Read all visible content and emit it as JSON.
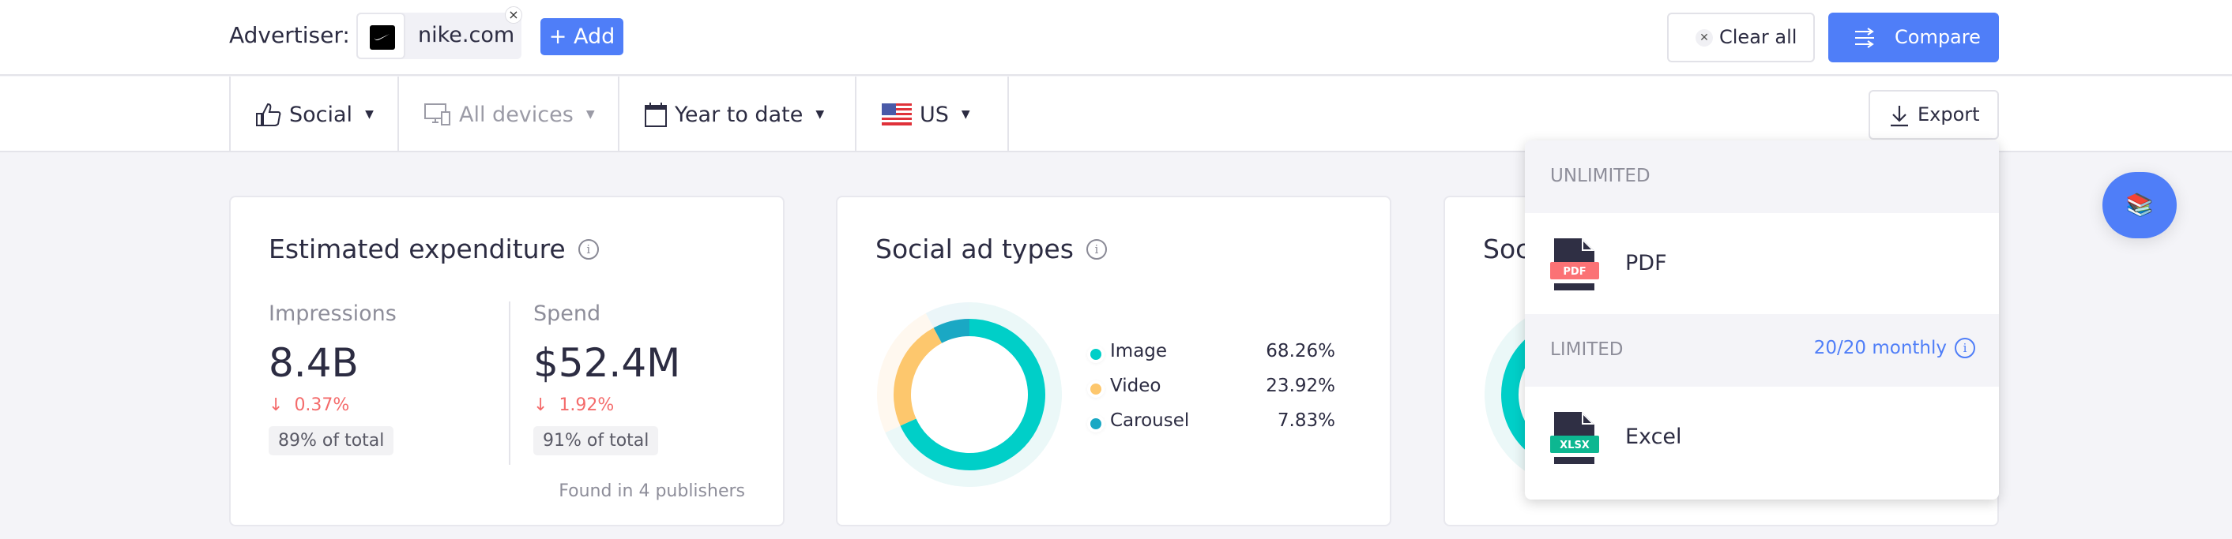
{
  "header": {
    "advertiser_label": "Advertiser:",
    "advertiser_chip": {
      "domain": "nike.com",
      "logo": "nike-swoosh-logo",
      "remove_icon": "close-icon"
    },
    "add_button": "+ Add",
    "clear_all_button": "Clear all",
    "compare_button": "Compare"
  },
  "filters": [
    {
      "icon": "thumbs-up-icon",
      "label": "Social",
      "disabled": false
    },
    {
      "icon": "devices-icon",
      "label": "All devices",
      "disabled": true
    },
    {
      "icon": "calendar-icon",
      "label": "Year to date",
      "disabled": false
    },
    {
      "icon": "us-flag-icon",
      "label": "US",
      "disabled": false
    }
  ],
  "export_button": "Export",
  "cards": {
    "expenditure": {
      "title": "Estimated expenditure",
      "impressions": {
        "label": "Impressions",
        "value": "8.4B",
        "delta": "0.37%",
        "delta_direction": "down",
        "share": "89% of total"
      },
      "spend": {
        "label": "Spend",
        "value": "$52.4M",
        "delta": "1.92%",
        "delta_direction": "down",
        "share": "91% of total"
      },
      "footer": "Found in 4 publishers"
    },
    "ad_types": {
      "title": "Social ad types"
    },
    "third": {
      "title": "Soc"
    }
  },
  "chart_data": {
    "type": "pie",
    "title": "Social ad types",
    "categories": [
      "Image",
      "Video",
      "Carousel"
    ],
    "values": [
      68.26,
      23.92,
      7.83
    ],
    "labels": [
      "68.26%",
      "23.92%",
      "7.83%"
    ],
    "colors": [
      "#00cfc8",
      "#fdc76d",
      "#1aa8c4"
    ],
    "legend": "right",
    "donut": true
  },
  "export_menu": {
    "sections": [
      {
        "label": "UNLIMITED",
        "items": [
          {
            "name": "PDF",
            "badge": "PDF",
            "badge_color": "#fb7275"
          }
        ]
      },
      {
        "label": "LIMITED",
        "quota": "20/20 monthly",
        "items": [
          {
            "name": "Excel",
            "badge": "XLSX",
            "badge_color": "#0db791"
          }
        ]
      }
    ]
  },
  "fab": {
    "icon": "books-icon",
    "glyph": "📚"
  },
  "colors": {
    "accent": "#4f7ef8",
    "negative": "#f46b6b",
    "text": "#2c2c42"
  }
}
